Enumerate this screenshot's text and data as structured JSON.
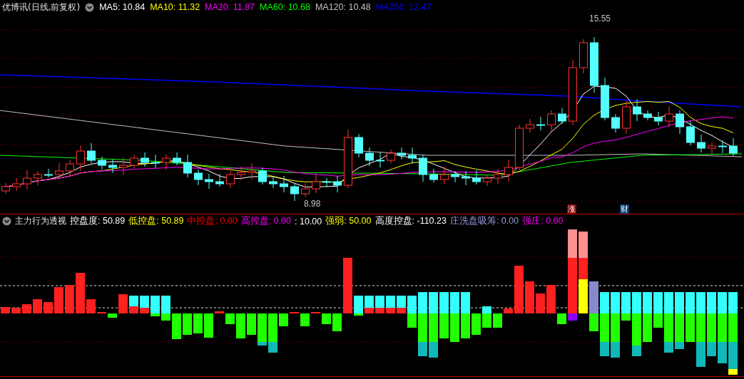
{
  "header": {
    "title": "优博讯(日线,前复权)",
    "moving_averages": [
      {
        "label": "MA5: 10.84",
        "color": "#ffffff"
      },
      {
        "label": "MA10: 11.32",
        "color": "#ffff00"
      },
      {
        "label": "MA20: 11.87",
        "color": "#ff00ff"
      },
      {
        "label": "MA60: 10.68",
        "color": "#00ff00"
      },
      {
        "label": "MA120: 10.48",
        "color": "#c0c0c0"
      },
      {
        "label": "MA250: 12.47",
        "color": "#0000ff"
      }
    ]
  },
  "price_chart": {
    "high_label": "15.55",
    "low_label": "8.98",
    "badges": [
      {
        "text": "涨",
        "color": "#8b0000"
      },
      {
        "text": "财",
        "color": "#0b3d6e"
      }
    ]
  },
  "indicator": {
    "title": "主力行为透视",
    "values": [
      {
        "label": "控盘度: 50.89",
        "color": "#ffffff"
      },
      {
        "label": "低控盘: 50.89",
        "color": "#ffff00"
      },
      {
        "label": "中控盘: 0.00",
        "color": "#ff0000"
      },
      {
        "label": "高控盘: 0.00",
        "color": "#ff00ff"
      },
      {
        "label": ": 10.00",
        "color": "#ffffff"
      },
      {
        "label": "强弱: 50.00",
        "color": "#ffff00"
      },
      {
        "label": "高度控盘: -110.23",
        "color": "#ffffff"
      },
      {
        "label": "庄洗盘吸筹: 0.00",
        "color": "#9999dd"
      },
      {
        "label": "强庄: 0.00",
        "color": "#ff00ff"
      }
    ]
  }
}
